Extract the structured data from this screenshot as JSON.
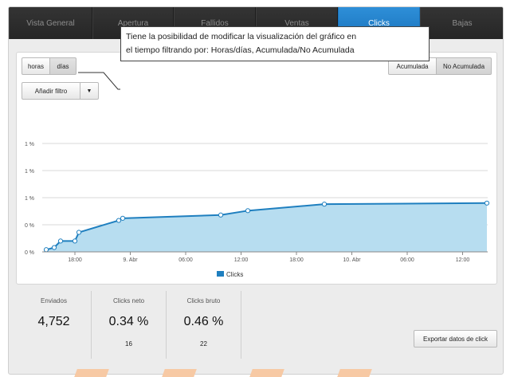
{
  "tabs": [
    {
      "label": "Vista General",
      "active": false
    },
    {
      "label": "Apertura",
      "active": false
    },
    {
      "label": "Fallidos",
      "active": false
    },
    {
      "label": "Ventas",
      "active": false
    },
    {
      "label": "Clicks",
      "active": true
    },
    {
      "label": "Bajas",
      "active": false
    }
  ],
  "toggles": {
    "horas": "horas",
    "dias": "días",
    "filter_label": "Añadir filtro",
    "acumulada": "Acumulada",
    "no_acumulada": "No Acumulada"
  },
  "callout": {
    "line1": "Tiene la posibilidad de modificar la visualización del gráfico en",
    "line2": "el tiempo filtrando por:  Horas/días, Acumulada/No Acumulada"
  },
  "chart_data": {
    "type": "area",
    "y_tick_labels": [
      "1 %",
      "1 %",
      "1 %",
      "0 %",
      "0 %"
    ],
    "x_tick_labels": [
      "18:00",
      "9. Abr",
      "06:00",
      "12:00",
      "18:00",
      "10. Abr",
      "06:00",
      "12:00"
    ],
    "series": [
      {
        "name": "Clicks",
        "color": "#1f7fbf",
        "fill": "#b7ddf0",
        "values": [
          0.02,
          0.04,
          0.1,
          0.1,
          0.18,
          0.29,
          0.31,
          0.34,
          0.38,
          0.44,
          0.45,
          0.46
        ]
      }
    ],
    "ylim": [
      0,
      1.0
    ],
    "grid": true,
    "legend": "bottom-center"
  },
  "stats": [
    {
      "label": "Enviados",
      "value": "4,752",
      "sub": ""
    },
    {
      "label": "Clicks neto",
      "value": "0.34 %",
      "sub": "16"
    },
    {
      "label": "Clicks bruto",
      "value": "0.46 %",
      "sub": "22"
    }
  ],
  "export_label": "Exportar datos de click"
}
